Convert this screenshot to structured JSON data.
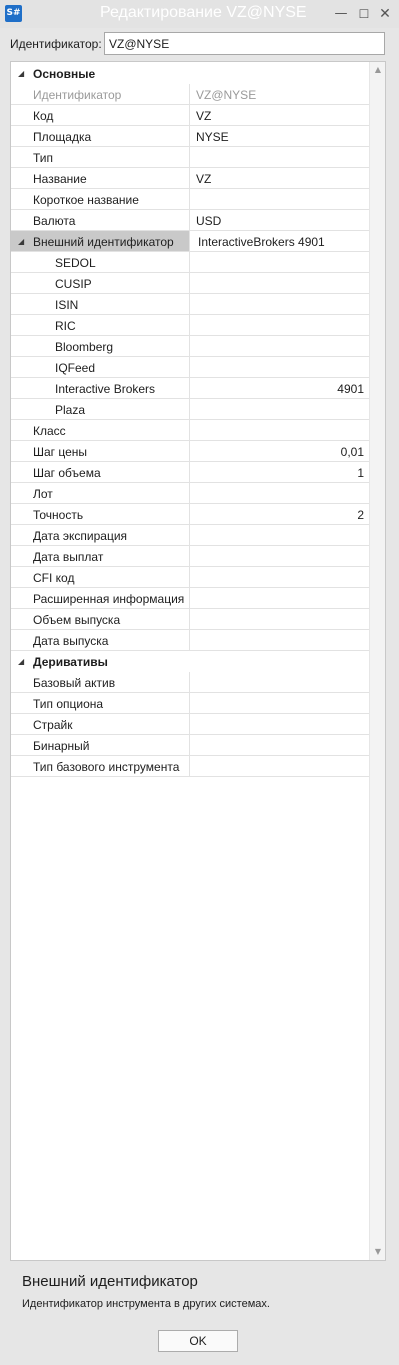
{
  "window": {
    "app_icon": "S#",
    "title": "Редактирование VZ@NYSE",
    "icons": {
      "minimize": "minimize-icon",
      "maximize": "maximize-icon",
      "close": "close-icon"
    }
  },
  "identifier_field": {
    "label": "Идентификатор:",
    "value": "VZ@NYSE"
  },
  "grid": {
    "rows": [
      {
        "type": "category",
        "label": "Основные"
      },
      {
        "type": "prop",
        "name": "Идентификатор",
        "value": "VZ@NYSE",
        "align": "left",
        "dim": true
      },
      {
        "type": "prop",
        "name": "Код",
        "value": "VZ",
        "align": "left"
      },
      {
        "type": "prop",
        "name": "Площадка",
        "value": "NYSE",
        "align": "left"
      },
      {
        "type": "prop",
        "name": "Тип",
        "value": "",
        "align": "left"
      },
      {
        "type": "prop",
        "name": "Название",
        "value": "VZ",
        "align": "left"
      },
      {
        "type": "prop",
        "name": "Короткое название",
        "value": "",
        "align": "left"
      },
      {
        "type": "prop",
        "name": "Валюта",
        "value": "USD",
        "align": "left"
      },
      {
        "type": "prop",
        "name": "Внешний идентификатор",
        "value": "InteractiveBrokers 4901",
        "align": "left",
        "selected": true,
        "expandable": true
      },
      {
        "type": "prop",
        "name": "SEDOL",
        "value": "",
        "align": "left",
        "child": true
      },
      {
        "type": "prop",
        "name": "CUSIP",
        "value": "",
        "align": "left",
        "child": true
      },
      {
        "type": "prop",
        "name": "ISIN",
        "value": "",
        "align": "left",
        "child": true
      },
      {
        "type": "prop",
        "name": "RIC",
        "value": "",
        "align": "left",
        "child": true
      },
      {
        "type": "prop",
        "name": "Bloomberg",
        "value": "",
        "align": "left",
        "child": true
      },
      {
        "type": "prop",
        "name": "IQFeed",
        "value": "",
        "align": "left",
        "child": true
      },
      {
        "type": "prop",
        "name": "Interactive Brokers",
        "value": "4901",
        "align": "right",
        "child": true
      },
      {
        "type": "prop",
        "name": "Plaza",
        "value": "",
        "align": "left",
        "child": true
      },
      {
        "type": "prop",
        "name": "Класс",
        "value": "",
        "align": "left"
      },
      {
        "type": "prop",
        "name": "Шаг цены",
        "value": "0,01",
        "align": "right"
      },
      {
        "type": "prop",
        "name": "Шаг объема",
        "value": "1",
        "align": "right"
      },
      {
        "type": "prop",
        "name": "Лот",
        "value": "",
        "align": "left"
      },
      {
        "type": "prop",
        "name": "Точность",
        "value": "2",
        "align": "right"
      },
      {
        "type": "prop",
        "name": "Дата экспирация",
        "value": "",
        "align": "left"
      },
      {
        "type": "prop",
        "name": "Дата выплат",
        "value": "",
        "align": "left"
      },
      {
        "type": "prop",
        "name": "CFI код",
        "value": "",
        "align": "left"
      },
      {
        "type": "prop",
        "name": "Расширенная информация",
        "value": "",
        "align": "left"
      },
      {
        "type": "prop",
        "name": "Объем выпуска",
        "value": "",
        "align": "left"
      },
      {
        "type": "prop",
        "name": "Дата выпуска",
        "value": "",
        "align": "left"
      },
      {
        "type": "category",
        "label": "Деривативы"
      },
      {
        "type": "prop",
        "name": "Базовый актив",
        "value": "",
        "align": "left"
      },
      {
        "type": "prop",
        "name": "Тип опциона",
        "value": "",
        "align": "left"
      },
      {
        "type": "prop",
        "name": "Страйк",
        "value": "",
        "align": "left"
      },
      {
        "type": "prop",
        "name": "Бинарный",
        "value": "",
        "align": "left"
      },
      {
        "type": "prop",
        "name": "Тип базового инструмента",
        "value": "",
        "align": "left"
      }
    ]
  },
  "description": {
    "title": "Внешний идентификатор",
    "text": "Идентификатор инструмента в других системах."
  },
  "ok_button": {
    "label": "OK"
  },
  "colors": {
    "title_bar": "#e3e3e3",
    "selected_row": "#c9c9c9",
    "app_icon": "#1f6fc8",
    "dim_text": "#9a9a9a"
  }
}
